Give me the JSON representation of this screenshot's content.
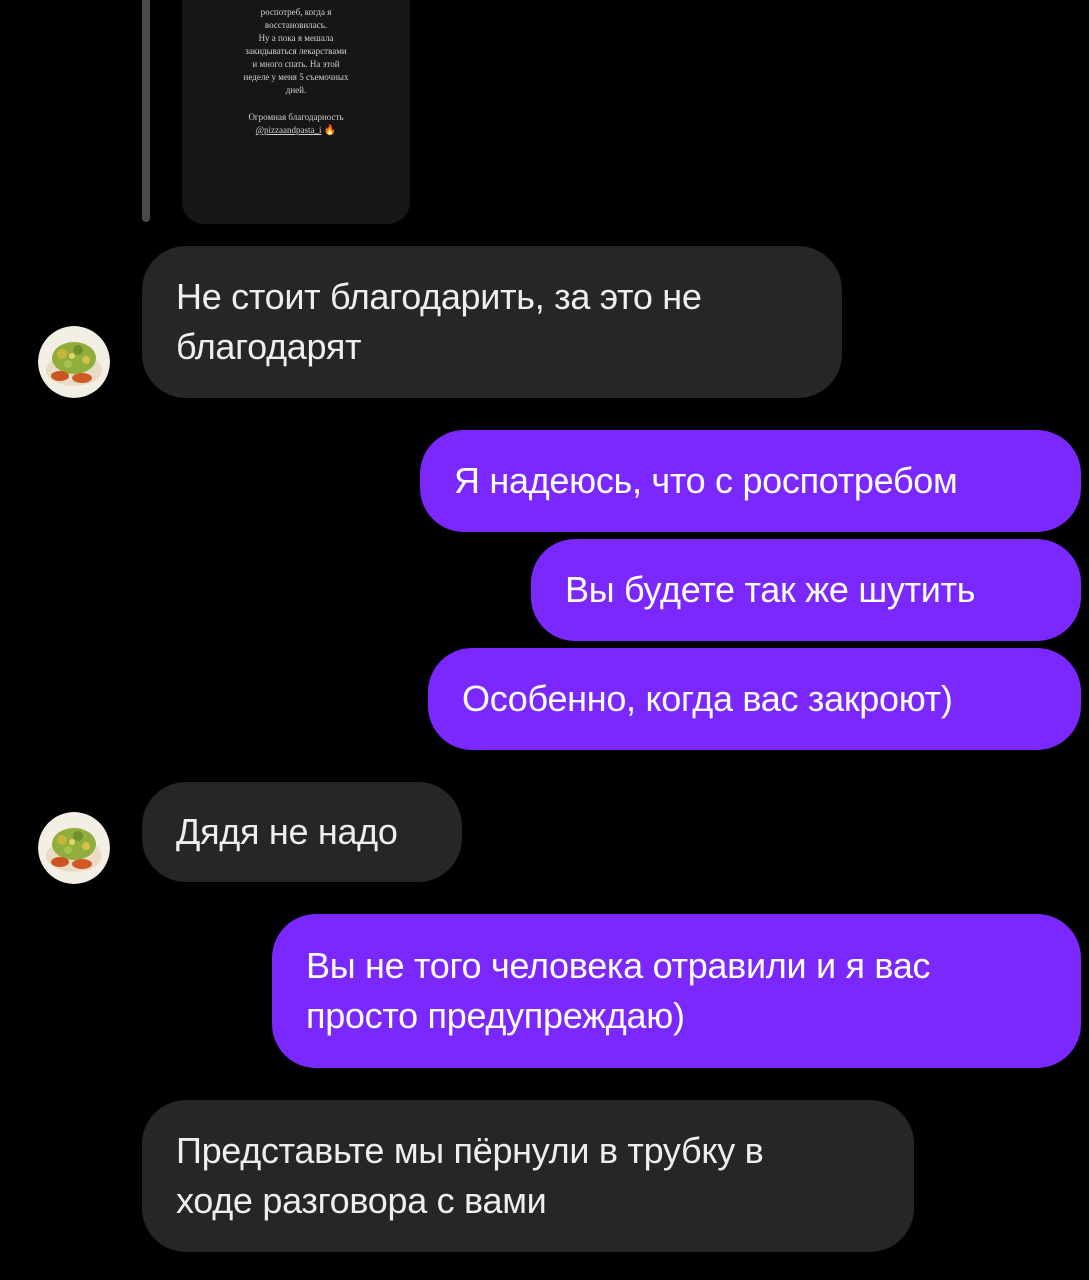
{
  "story_reply": {
    "lines": [
      "роспотреб, когда я",
      "восстановилась.",
      "Ну а пока я мешала",
      "закидываться лекарствами",
      "и много спать. На этой",
      "неделе у меня 5 съемочных",
      "дней."
    ],
    "thanks_line": "Огромная благодарность",
    "mention": "@pizzaandpasta_i",
    "fire_emoji": "🔥"
  },
  "messages": [
    {
      "id": 1,
      "direction": "incoming",
      "lines": [
        "Не стоит благодарить, за это не",
        "благодарят"
      ]
    },
    {
      "id": 2,
      "direction": "outgoing",
      "lines": [
        "Я надеюсь, что с роспотребом"
      ]
    },
    {
      "id": 3,
      "direction": "outgoing",
      "lines": [
        "Вы будете так же шутить"
      ]
    },
    {
      "id": 4,
      "direction": "outgoing",
      "lines": [
        "Особенно, когда вас закроют)"
      ]
    },
    {
      "id": 5,
      "direction": "incoming",
      "lines": [
        "Дядя не надо"
      ]
    },
    {
      "id": 6,
      "direction": "outgoing",
      "lines": [
        "Вы не того человека отравили и я вас",
        "просто предупреждаю)"
      ]
    },
    {
      "id": 7,
      "direction": "incoming",
      "lines": [
        "Представьте мы пёрнули в трубку в",
        "ходе разговора с вами"
      ]
    }
  ],
  "colors": {
    "background": "#000000",
    "incoming_bubble": "#262628",
    "outgoing_bubble": "#7b28ff",
    "text": "#eeeeee"
  },
  "icons": {
    "avatar": "food-plate-avatar-icon"
  }
}
